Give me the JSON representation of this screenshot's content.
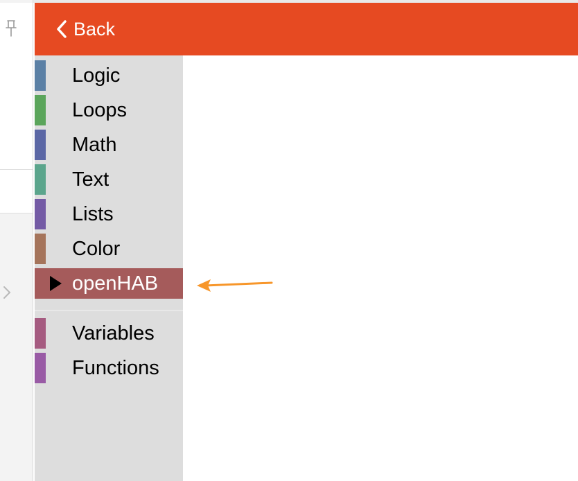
{
  "header": {
    "back_label": "Back",
    "color": "#e64a22"
  },
  "toolbox": {
    "categories": [
      {
        "label": "Logic",
        "color": "#5b80a5"
      },
      {
        "label": "Loops",
        "color": "#5ba55b"
      },
      {
        "label": "Math",
        "color": "#5b67a5"
      },
      {
        "label": "Text",
        "color": "#5ba58c"
      },
      {
        "label": "Lists",
        "color": "#745ba5"
      },
      {
        "label": "Color",
        "color": "#a5745b"
      },
      {
        "label": "openHAB",
        "color": "#a55b5b",
        "selected": true,
        "expander_icon": "triangle-right-icon"
      },
      {
        "label": "Variables",
        "color": "#a55b80"
      },
      {
        "label": "Functions",
        "color": "#995ba5"
      }
    ]
  },
  "annotation": {
    "icon": "arrow-left-icon",
    "color": "#f7962a"
  },
  "sidebar": {
    "icons": [
      "pin-icon",
      "chevron-right-icon"
    ]
  }
}
